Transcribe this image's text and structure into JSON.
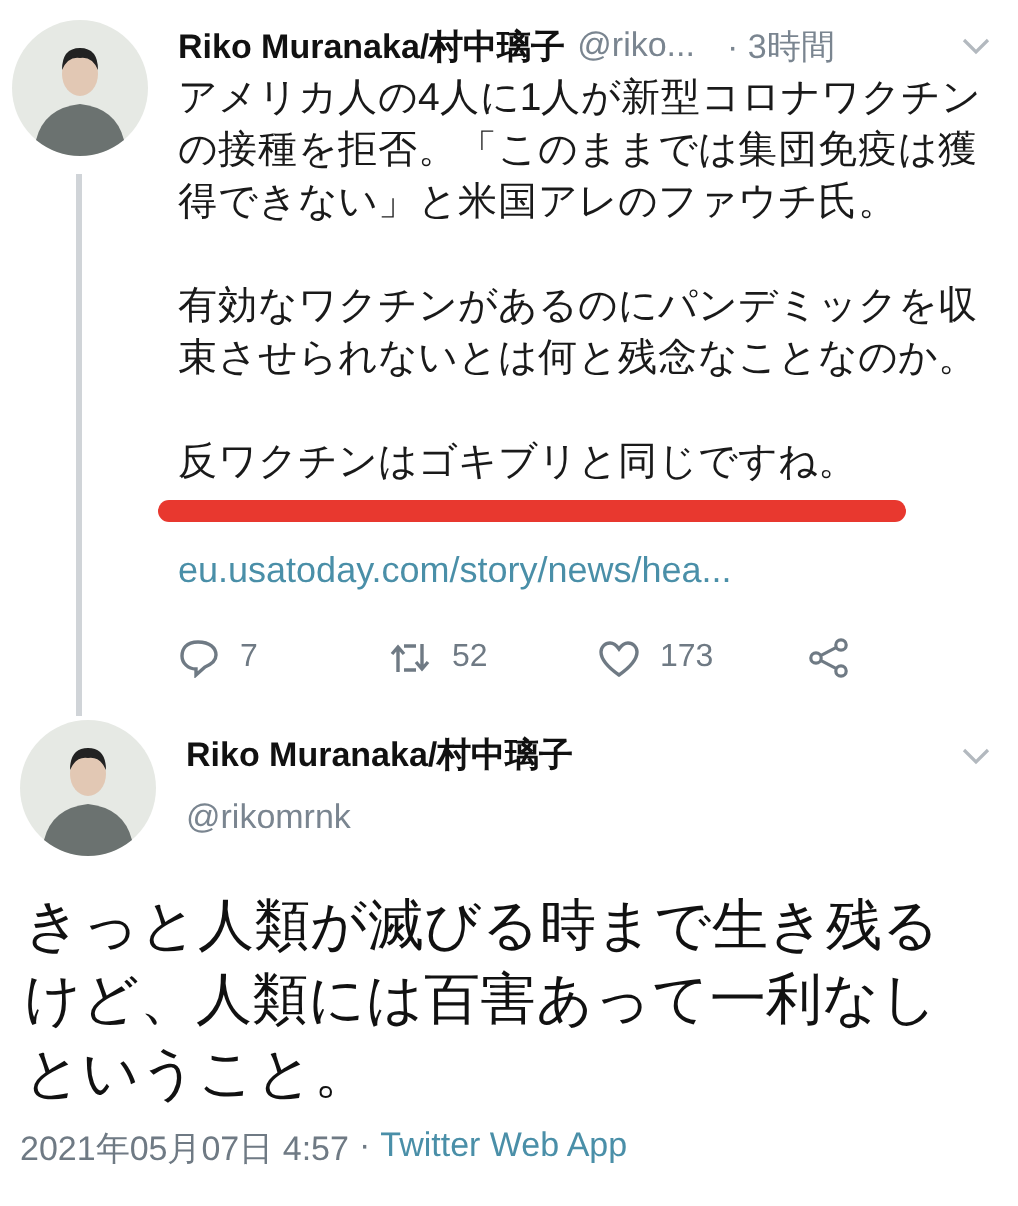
{
  "tweets": [
    {
      "kind": "thread",
      "name": "Riko Muranaka/村中璃子",
      "handle": "@riko...",
      "time": "· 3時間",
      "paragraphs": [
        {
          "text": "アメリカ人の4人に1人が新型コロナワクチンの接種を拒否。「このままでは集団免疫は獲得できない」と米国アレのファウチ氏。",
          "underlined": false
        },
        {
          "text": "有効なワクチンがあるのにパンデミックを収束させられないとは何と残念なことなのか。",
          "underlined": false
        },
        {
          "text": "反ワクチンはゴキブリと同じですね。",
          "underlined": true
        }
      ],
      "link": "eu.usatoday.com/story/news/hea...",
      "actions": [
        {
          "kind": "reply",
          "count": "7"
        },
        {
          "kind": "retweet",
          "count": "52"
        },
        {
          "kind": "like",
          "count": "173"
        },
        {
          "kind": "share"
        }
      ]
    },
    {
      "kind": "focused",
      "name": "Riko Muranaka/村中璃子",
      "handle": "@rikomrnk",
      "text": "きっと人類が滅びる時まで生き残るけど、人類には百害あって一利なしということ。",
      "date": "2021年05月07日 4:57",
      "separator": "·",
      "source": "Twitter Web App"
    }
  ]
}
